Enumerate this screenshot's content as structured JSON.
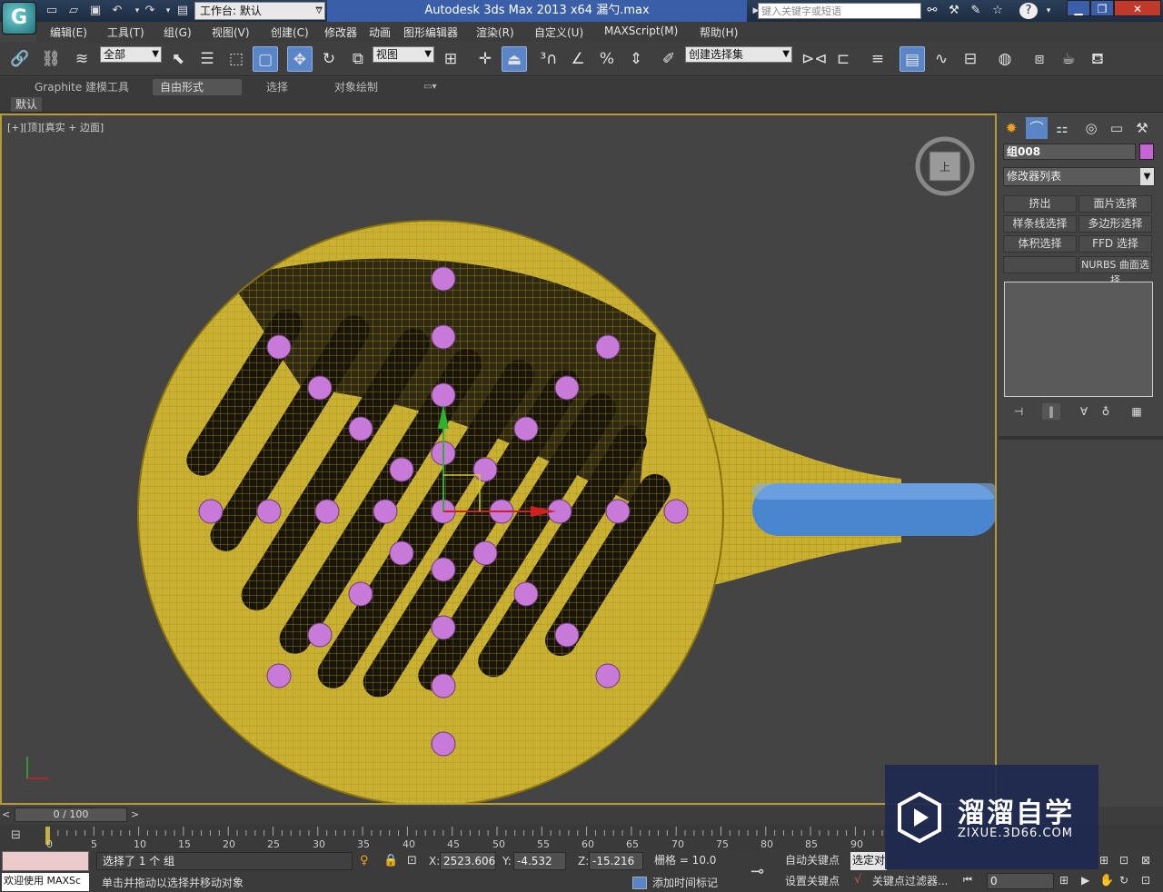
{
  "titlebar": {
    "workspace": "工作台: 默认",
    "title": "Autodesk 3ds Max  2013 x64      漏勺.max",
    "search_placeholder": "键入关键字或短语",
    "help": "?"
  },
  "menu": [
    "编辑(E)",
    "工具(T)",
    "组(G)",
    "视图(V)",
    "创建(C)",
    "修改器",
    "动画",
    "图形编辑器",
    "渲染(R)",
    "自定义(U)",
    "MAXScript(M)",
    "帮助(H)"
  ],
  "toolbar": {
    "filter_combo": "全部",
    "refcoord_combo": "视图",
    "named_selection_combo": "创建选择集"
  },
  "ribbon": {
    "tabs": [
      "Graphite 建模工具",
      "自由形式",
      "选择",
      "对象绘制"
    ],
    "active_tab": "自由形式",
    "subtab": "默认"
  },
  "viewport": {
    "label": "[+][顶][真实 + 边面]",
    "viewcube_face": "上"
  },
  "command_panel": {
    "object_name": "组008",
    "object_color": "#c864d8",
    "modifier_list": "修改器列表",
    "modifier_buttons": [
      "挤出",
      "面片选择",
      "样条线选择",
      "多边形选择",
      "体积选择",
      "FFD 选择",
      "",
      "NURBS 曲面选择"
    ]
  },
  "timeline": {
    "slider": "0 / 100",
    "ticks": [
      "0",
      "5",
      "10",
      "15",
      "20",
      "25",
      "30",
      "35",
      "40",
      "45",
      "50",
      "55",
      "60",
      "65",
      "70",
      "75",
      "80",
      "85",
      "90"
    ]
  },
  "status": {
    "welcome": "欢迎使用 MAXSc",
    "selection": "选择了 1 个 组",
    "prompt": "单击并拖动以选择并移动对象",
    "x_label": "X:",
    "x": "2523.606",
    "y_label": "Y:",
    "y": "-4.532",
    "z_label": "Z:",
    "z": "-15.216",
    "grid": "栅格 = 10.0",
    "auto_key": "自动关键点",
    "set_key": "设置关键点",
    "selected_combo": "选定对",
    "key_filters": "关键点过滤器...",
    "add_time_tag": "添加时间标记",
    "frame": "0"
  },
  "watermark": {
    "brand": "溜溜自学",
    "url": "ZIXUE.3D66.COM"
  },
  "colors": {
    "accent_blue": "#5a86c8",
    "mesh_yellow": "#c8b030",
    "handle_blue": "#4a86d0",
    "dot_pink": "#c77ad8"
  }
}
